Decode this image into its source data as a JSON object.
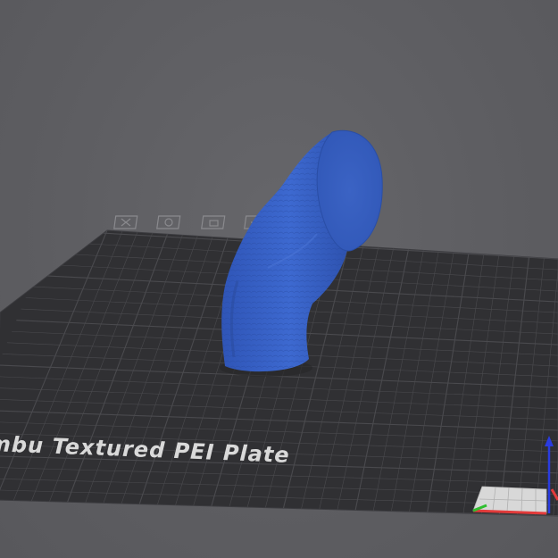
{
  "plate": {
    "label": "Bambu Textured PEI Plate"
  },
  "plate_icons": [
    "close-x-icon",
    "auto-orient-icon",
    "lock-icon",
    "settings-icon"
  ],
  "axis_colors": {
    "x": "#e23b3b",
    "y": "#2fbf2f",
    "z": "#2a3ce0"
  },
  "colors": {
    "background": "#5f5f63",
    "plate": "#303033",
    "grid": "#4a4a4e",
    "model": "#3a64c8"
  }
}
